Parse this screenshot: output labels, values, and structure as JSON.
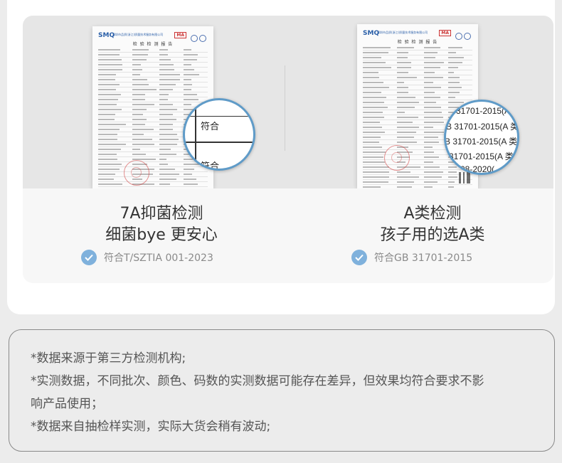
{
  "left_item": {
    "document": {
      "logo": "SMQ",
      "logo_sub": "深圳市品质(浙江)质量技术服务有限公司",
      "cma_mark": "MA",
      "title": "检 验 检 测 报 告"
    },
    "magnifier": {
      "top_text": "符合",
      "bottom_text": "符合"
    },
    "headline_1": "7A抑菌检测",
    "headline_2": "细菌bye 更安心",
    "cert_label": "符合T/SZTIA 001-2023",
    "cert_icon": "check-circle-icon",
    "accent_color": "#7fb1dc"
  },
  "right_item": {
    "document": {
      "logo": "SMQ",
      "logo_sub": "深圳市品质(浙江)质量技术服务有限公司",
      "cma_mark": "MA",
      "title": "检 验 检 测 报 告"
    },
    "magnifier": {
      "lines": [
        "31701-2015(A",
        "B 31701-2015(A 类",
        "B 31701-2015(A 类)",
        "31701-2015(A 类",
        "08-2020("
      ]
    },
    "headline_1": "A类检测",
    "headline_2": "孩子用的选A类",
    "cert_label": "符合GB 31701-2015",
    "cert_icon": "check-circle-icon",
    "accent_color": "#7fb1dc"
  },
  "notes": [
    "*数据来源于第三方检测机构;",
    "*实测数据，不同批次、颜色、码数的实测数据可能存在差异，但效果均符合要求不影",
    "响产品使用；",
    "*数据来自抽检样实测，实际大货会稍有波动;"
  ]
}
